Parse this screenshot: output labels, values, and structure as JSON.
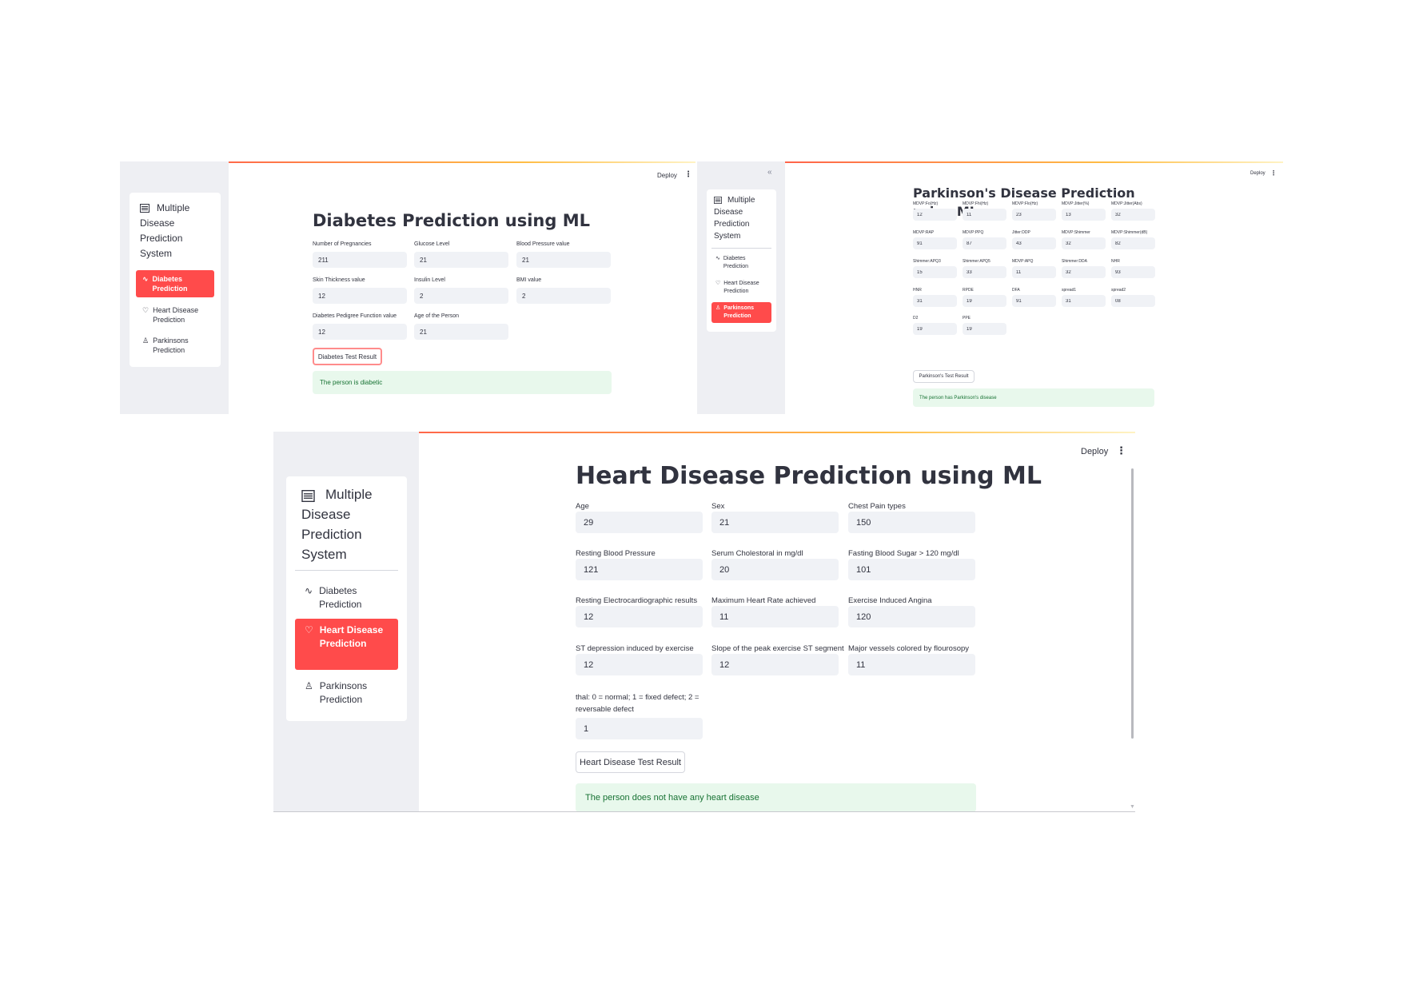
{
  "brand": {
    "icon": "list-icon",
    "line1": "Multiple",
    "line2": "Disease",
    "line3": "Prediction",
    "line4": "System"
  },
  "nav": {
    "diabetes": "Diabetes Prediction",
    "diabetes_icon": "activity-icon",
    "heart": "Heart Disease Prediction",
    "heart_icon": "heart-icon",
    "parkinsons": "Parkinsons Prediction",
    "parkinsons_icon": "person-icon"
  },
  "toolbar": {
    "deploy": "Deploy",
    "menu_icon": "kebab-icon",
    "collapse": "«"
  },
  "diabetes": {
    "title": "Diabetes Prediction using ML",
    "fields": [
      {
        "label": "Number of Pregnancies",
        "value": "211"
      },
      {
        "label": "Glucose Level",
        "value": "21"
      },
      {
        "label": "Blood Pressure value",
        "value": "21"
      },
      {
        "label": "Skin Thickness value",
        "value": "12"
      },
      {
        "label": "Insulin Level",
        "value": "2"
      },
      {
        "label": "BMI value",
        "value": "2"
      },
      {
        "label": "Diabetes Pedigree Function value",
        "value": "12"
      },
      {
        "label": "Age of the Person",
        "value": "21"
      }
    ],
    "button": "Diabetes Test Result",
    "result": "The person is diabetic"
  },
  "parkinsons": {
    "title_line1": "Parkinson's Disease Prediction",
    "title_line2": "using ML",
    "fields": [
      {
        "label": "MDVP:Fo(Hz)",
        "value": "12"
      },
      {
        "label": "MDVP:Fhi(Hz)",
        "value": "11"
      },
      {
        "label": "MDVP:Flo(Hz)",
        "value": "23"
      },
      {
        "label": "MDVP:Jitter(%)",
        "value": "13"
      },
      {
        "label": "MDVP:Jitter(Abs)",
        "value": "32"
      },
      {
        "label": "MDVP:RAP",
        "value": "91"
      },
      {
        "label": "MDVP:PPQ",
        "value": "87"
      },
      {
        "label": "Jitter:DDP",
        "value": "43"
      },
      {
        "label": "MDVP:Shimmer",
        "value": "32"
      },
      {
        "label": "MDVP:Shimmer(dB)",
        "value": "82"
      },
      {
        "label": "Shimmer:APQ3",
        "value": "15"
      },
      {
        "label": "Shimmer:APQ5",
        "value": "33"
      },
      {
        "label": "MDVP:APQ",
        "value": "11"
      },
      {
        "label": "Shimmer:DDA",
        "value": "32"
      },
      {
        "label": "NHR",
        "value": "93"
      },
      {
        "label": "HNR",
        "value": "31"
      },
      {
        "label": "RPDE",
        "value": "19"
      },
      {
        "label": "DFA",
        "value": "91"
      },
      {
        "label": "spread1",
        "value": "31"
      },
      {
        "label": "spread2",
        "value": "08"
      },
      {
        "label": "D2",
        "value": "19"
      },
      {
        "label": "PPE",
        "value": "19"
      }
    ],
    "button": "Parkinson's Test Result",
    "result": "The person has Parkinson's disease"
  },
  "heart": {
    "title": "Heart Disease Prediction using ML",
    "fields": [
      {
        "label": "Age",
        "value": "29"
      },
      {
        "label": "Sex",
        "value": "21"
      },
      {
        "label": "Chest Pain types",
        "value": "150"
      },
      {
        "label": "Resting Blood Pressure",
        "value": "121"
      },
      {
        "label": "Serum Cholestoral in mg/dl",
        "value": "20"
      },
      {
        "label": "Fasting Blood Sugar > 120 mg/dl",
        "value": "101"
      },
      {
        "label": "Resting Electrocardiographic results",
        "value": "12"
      },
      {
        "label": "Maximum Heart Rate achieved",
        "value": "11"
      },
      {
        "label": "Exercise Induced Angina",
        "value": "120"
      },
      {
        "label": "ST depression induced by exercise",
        "value": "12"
      },
      {
        "label": "Slope of the peak exercise ST segment",
        "value": "12"
      },
      {
        "label": "Major vessels colored by flourosopy",
        "value": "11"
      },
      {
        "label": "thal: 0 = normal; 1 = fixed defect; 2 = reversable defect",
        "value": "1"
      }
    ],
    "button": "Heart Disease Test Result",
    "result": "The person does not have any heart disease"
  },
  "colors": {
    "accent": "#ff4b4b",
    "success_bg": "#e8f8ec",
    "success_text": "#177233",
    "sidebar": "#eeeff3",
    "input": "#f0f2f6"
  }
}
